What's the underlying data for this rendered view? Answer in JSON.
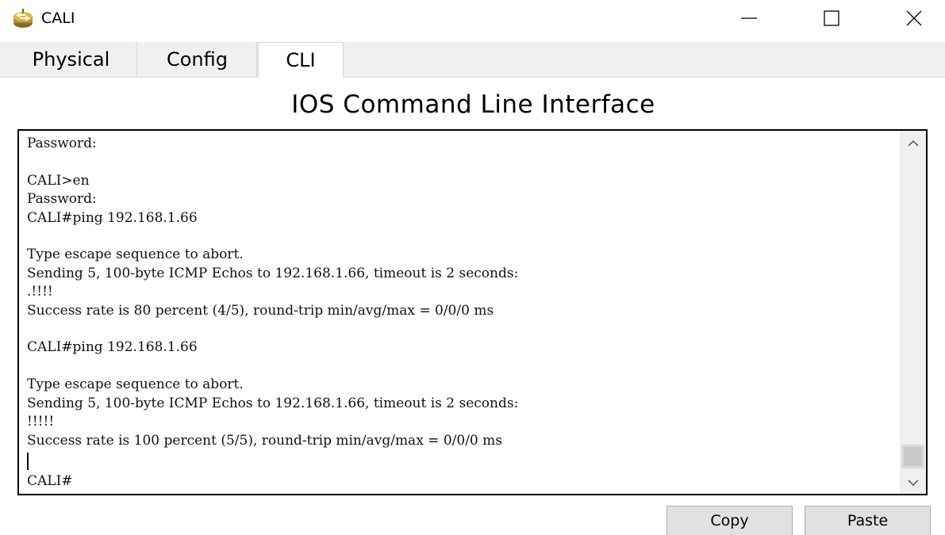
{
  "window": {
    "title": "CALI",
    "icon": "router-device-icon",
    "controls": [
      "minimize-icon",
      "maximize-icon",
      "close-icon"
    ]
  },
  "tabs": [
    {
      "label": "Physical",
      "active": false
    },
    {
      "label": "Config",
      "active": false
    },
    {
      "label": "CLI",
      "active": true
    }
  ],
  "heading": "IOS Command Line Interface",
  "console": {
    "lines": [
      "Password:",
      "",
      "CALI>en",
      "Password:",
      "CALI#ping 192.168.1.66",
      "",
      "Type escape sequence to abort.",
      "Sending 5, 100-byte ICMP Echos to 192.168.1.66, timeout is 2 seconds:",
      ".!!!!",
      "Success rate is 80 percent (4/5), round-trip min/avg/max = 0/0/0 ms",
      "",
      "CALI#ping 192.168.1.66",
      "",
      "Type escape sequence to abort.",
      "Sending 5, 100-byte ICMP Echos to 192.168.1.66, timeout is 2 seconds:",
      "!!!!!",
      "Success rate is 100 percent (5/5), round-trip min/avg/max = 0/0/0 ms"
    ],
    "prompt": "CALI#"
  },
  "buttons": {
    "copy": "Copy",
    "paste": "Paste"
  },
  "colors": {
    "tab_strip_bg": "#f0f0f0",
    "button_bg": "#e1e1e1",
    "console_border": "#000000"
  }
}
